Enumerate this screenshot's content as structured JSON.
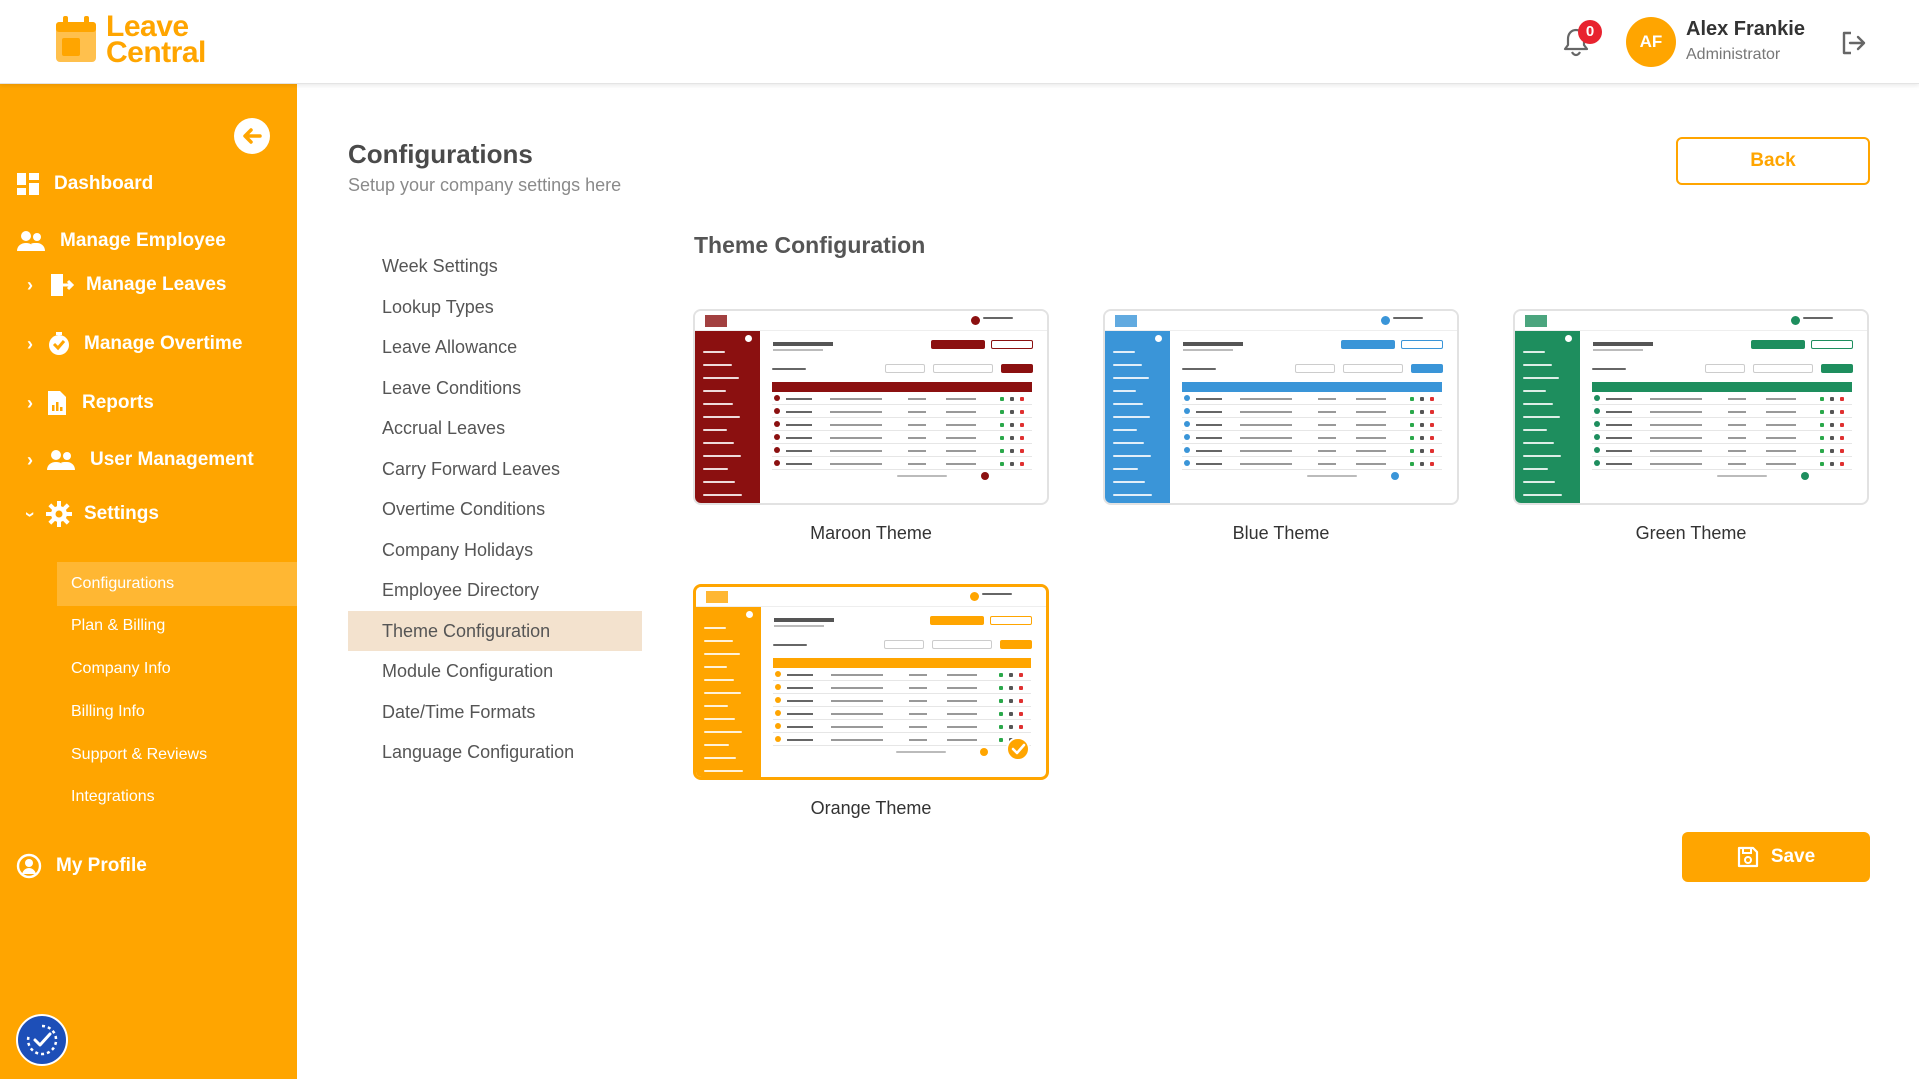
{
  "app": {
    "logo_line1": "Leave",
    "logo_line2": "Central",
    "brand_color": "#FFA500"
  },
  "header": {
    "notification_count": "0",
    "user_initials": "AF",
    "user_name": "Alex Frankie",
    "user_role": "Administrator"
  },
  "sidebar": {
    "items": [
      {
        "label": "Dashboard",
        "icon": "dashboard-icon"
      },
      {
        "label": "Manage Employee",
        "icon": "users-icon"
      },
      {
        "label": "Manage Leaves",
        "icon": "leave-icon",
        "expandable": true
      },
      {
        "label": "Manage Overtime",
        "icon": "overtime-icon",
        "expandable": true
      },
      {
        "label": "Reports",
        "icon": "report-icon",
        "expandable": true
      },
      {
        "label": "User Management",
        "icon": "user-management-icon",
        "expandable": true
      },
      {
        "label": "Settings",
        "icon": "gear-icon",
        "expanded": true
      }
    ],
    "settings_children": [
      {
        "label": "Configurations",
        "active": true
      },
      {
        "label": "Plan & Billing"
      },
      {
        "label": "Company Info"
      },
      {
        "label": "Billing Info"
      },
      {
        "label": "Support & Reviews"
      },
      {
        "label": "Integrations"
      }
    ],
    "profile_label": "My Profile"
  },
  "main": {
    "title": "Configurations",
    "subtitle": "Setup your company settings here",
    "back_label": "Back",
    "save_label": "Save",
    "config_menu": [
      {
        "label": "Week Settings"
      },
      {
        "label": "Lookup Types"
      },
      {
        "label": "Leave Allowance"
      },
      {
        "label": "Leave Conditions"
      },
      {
        "label": "Accrual Leaves"
      },
      {
        "label": "Carry Forward Leaves"
      },
      {
        "label": "Overtime Conditions"
      },
      {
        "label": "Company Holidays"
      },
      {
        "label": "Employee Directory"
      },
      {
        "label": "Theme Configuration",
        "active": true
      },
      {
        "label": "Module Configuration"
      },
      {
        "label": "Date/Time Formats"
      },
      {
        "label": "Language Configuration"
      }
    ],
    "section_title": "Theme Configuration",
    "themes": [
      {
        "label": "Maroon Theme",
        "color": "#8B1010",
        "selected": false
      },
      {
        "label": "Blue Theme",
        "color": "#3A95D8",
        "selected": false
      },
      {
        "label": "Green Theme",
        "color": "#1E8E5E",
        "selected": false
      },
      {
        "label": "Orange Theme",
        "color": "#FFA500",
        "selected": true
      }
    ]
  }
}
